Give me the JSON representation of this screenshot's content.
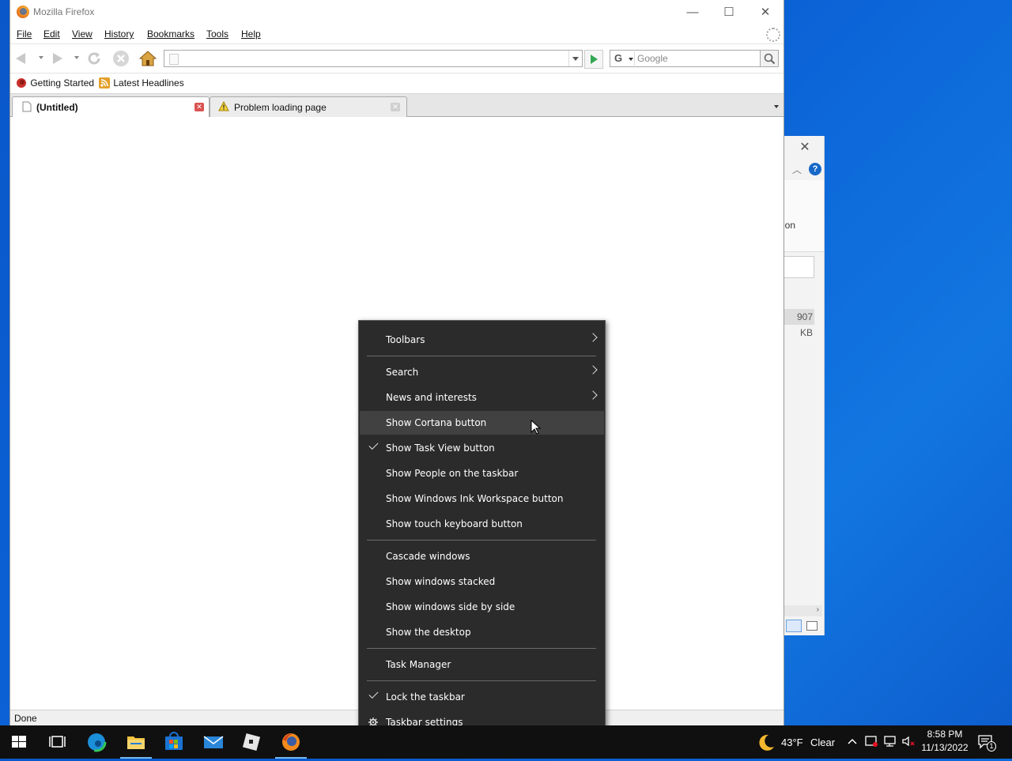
{
  "firefox": {
    "title": "Mozilla Firefox",
    "menu": [
      "File",
      "Edit",
      "View",
      "History",
      "Bookmarks",
      "Tools",
      "Help"
    ],
    "url": "",
    "search_placeholder": "Google",
    "bookmarks": [
      "Getting Started",
      "Latest Headlines"
    ],
    "tabs": [
      {
        "label": "(Untitled)",
        "active": true
      },
      {
        "label": "Problem loading page",
        "active": false
      }
    ],
    "status": "Done"
  },
  "bg_window": {
    "partial_label": "ion",
    "size_text": "907 KB"
  },
  "context_menu": {
    "items": [
      {
        "label": "Toolbars",
        "submenu": true
      },
      {
        "label": "Search",
        "submenu": true
      },
      {
        "label": "News and interests",
        "submenu": true
      },
      {
        "label": "Show Cortana button",
        "hover": true
      },
      {
        "label": "Show Task View button",
        "checked": true
      },
      {
        "label": "Show People on the taskbar"
      },
      {
        "label": "Show Windows Ink Workspace button"
      },
      {
        "label": "Show touch keyboard button"
      },
      {
        "label": "Cascade windows"
      },
      {
        "label": "Show windows stacked"
      },
      {
        "label": "Show windows side by side"
      },
      {
        "label": "Show the desktop"
      },
      {
        "label": "Task Manager"
      },
      {
        "label": "Lock the taskbar",
        "checked": true
      },
      {
        "label": "Taskbar settings",
        "icon": "gear-icon"
      }
    ]
  },
  "taskbar": {
    "weather_temp": "43°F",
    "weather_desc": "Clear",
    "time": "8:58 PM",
    "date": "11/13/2022",
    "notification_count": "1",
    "apps": [
      "start-icon",
      "task-view-icon",
      "edge-icon",
      "file-explorer-icon",
      "store-icon",
      "mail-icon",
      "app-icon",
      "firefox-icon"
    ]
  },
  "colors": {
    "desktop": "#0b62d6",
    "menu_bg": "#2b2b2b",
    "menu_hover": "#414141",
    "taskbar": "#101010",
    "accent": "#76b9ed"
  }
}
